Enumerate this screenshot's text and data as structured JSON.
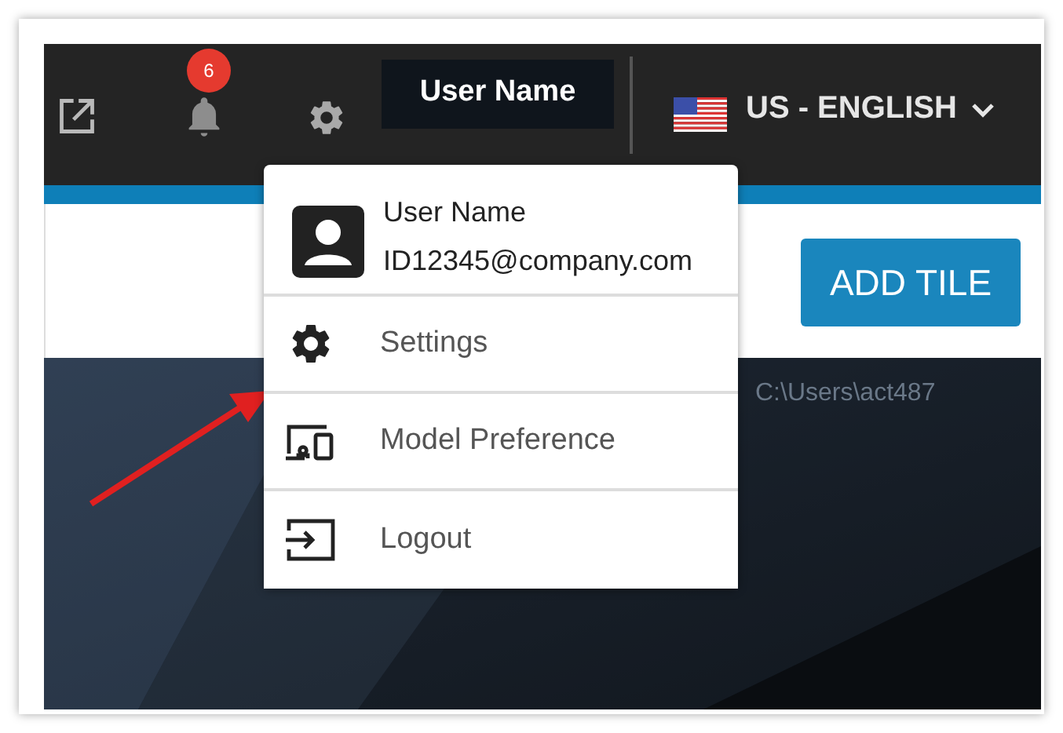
{
  "header": {
    "notifications_badge": "6",
    "user_button": "User Name",
    "language": "US - ENGLISH"
  },
  "toolbar": {
    "add_button": "ADD TILE"
  },
  "tile": {
    "path_text": "C:\\Users\\act487"
  },
  "user_menu": {
    "name": "User Name",
    "email": "ID12345@company.com",
    "items": [
      {
        "kind": "settings",
        "label": "Settings"
      },
      {
        "kind": "model",
        "label": "Model Preference"
      },
      {
        "kind": "logout",
        "label": "Logout"
      }
    ]
  }
}
